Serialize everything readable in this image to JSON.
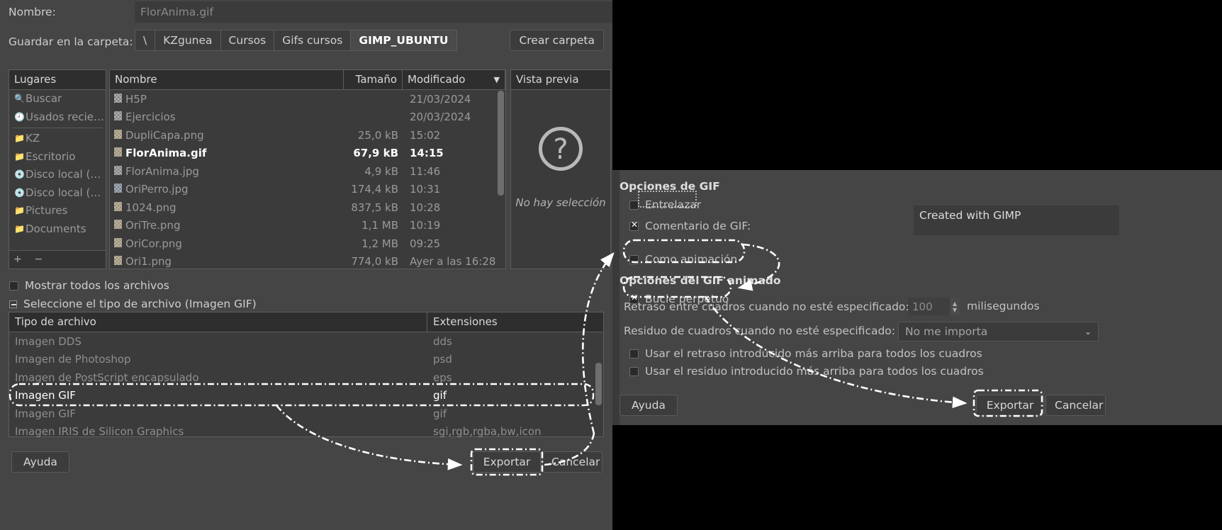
{
  "left_dialog": {
    "name_label": "Nombre:",
    "name_value": "FlorAnima.gif",
    "folder_label": "Guardar en la carpeta:",
    "breadcrumbs": [
      {
        "label": "\\",
        "active": false
      },
      {
        "label": "KZgunea",
        "active": false
      },
      {
        "label": "Cursos",
        "active": false
      },
      {
        "label": "Gifs cursos",
        "active": false
      },
      {
        "label": "GIMP_UBUNTU",
        "active": true
      }
    ],
    "create_folder_button": "Crear carpeta",
    "places_header": "Lugares",
    "places": [
      {
        "label": "Buscar",
        "icon": "search-icon"
      },
      {
        "label": "Usados recie…",
        "icon": "recent-icon"
      },
      {
        "label": "KZ",
        "icon": "folder-icon"
      },
      {
        "label": "Escritorio",
        "icon": "folder-icon"
      },
      {
        "label": "Disco local (…",
        "icon": "disk-icon"
      },
      {
        "label": "Disco local (…",
        "icon": "disk-icon"
      },
      {
        "label": "Pictures",
        "icon": "folder-icon"
      },
      {
        "label": "Documents",
        "icon": "folder-icon"
      }
    ],
    "places_add": "+",
    "places_remove": "−",
    "files_headers": {
      "name": "Nombre",
      "size": "Tamaño",
      "modified": "Modificado"
    },
    "files": [
      {
        "name": "H5P",
        "size": "",
        "modified": "21/03/2024",
        "thumb": "gray",
        "selected": false
      },
      {
        "name": "Ejercicios",
        "size": "",
        "modified": "20/03/2024",
        "thumb": "gray",
        "selected": false
      },
      {
        "name": "DupliCapa.png",
        "size": "25,0 kB",
        "modified": "15:02",
        "thumb": "tan",
        "selected": false
      },
      {
        "name": "FlorAnima.gif",
        "size": "67,9 kB",
        "modified": "14:15",
        "thumb": "tan",
        "selected": true
      },
      {
        "name": "FlorAnima.jpg",
        "size": "4,9 kB",
        "modified": "11:46",
        "thumb": "gray",
        "selected": false
      },
      {
        "name": "OriPerro.jpg",
        "size": "174,4 kB",
        "modified": "10:31",
        "thumb": "blue",
        "selected": false
      },
      {
        "name": "1024.png",
        "size": "837,5 kB",
        "modified": "10:28",
        "thumb": "tan",
        "selected": false
      },
      {
        "name": "OriTre.png",
        "size": "1,1 MB",
        "modified": "10:19",
        "thumb": "tan",
        "selected": false
      },
      {
        "name": "OriCor.png",
        "size": "1,2 MB",
        "modified": "09:25",
        "thumb": "tan",
        "selected": false
      },
      {
        "name": "Ori1.png",
        "size": "774,0 kB",
        "modified": "Ayer a las 16:28",
        "thumb": "tan",
        "selected": false
      }
    ],
    "preview_header": "Vista previa",
    "preview_placeholder": "?",
    "preview_text": "No hay selección",
    "show_all_files": "Mostrar todos los archivos",
    "select_file_type": "Seleccione el tipo de archivo (Imagen GIF)",
    "types_headers": {
      "type": "Tipo de archivo",
      "ext": "Extensiones"
    },
    "types": [
      {
        "type": "Imagen DDS",
        "ext": "dds",
        "selected": false
      },
      {
        "type": "Imagen de Photoshop",
        "ext": "psd",
        "selected": false
      },
      {
        "type": "Imagen de PostScript encapsulado",
        "ext": "eps",
        "selected": false
      },
      {
        "type": "Imagen GIF",
        "ext": "gif",
        "selected": true
      },
      {
        "type": "Imagen GIF",
        "ext": "gif",
        "selected": false
      },
      {
        "type": "Imagen IRIS de Silicon Graphics",
        "ext": "sgi,rgb,rgba,bw,icon",
        "selected": false
      }
    ],
    "help_button": "Ayuda",
    "export_button": "Exportar",
    "cancel_button": "Cancelar"
  },
  "right_dialog": {
    "section_gif": "Opciones de GIF",
    "interlace_label": "Entrelazar",
    "interlace_checked": false,
    "comment_label": "Comentario de GIF:",
    "comment_checked": true,
    "comment_value": "Created with GIMP",
    "as_animation_label": "Como animación",
    "as_animation_checked": false,
    "section_animated": "Opciones del GIF animado",
    "loop_label": "Bucle perpetuo",
    "loop_checked": true,
    "delay_label": "Retraso entre cuadros cuando no esté especificado:",
    "delay_value": "100",
    "delay_units": "milisegundos",
    "dispose_label": "Residuo de cuadros cuando no esté especificado:",
    "dispose_value": "No me importa",
    "use_delay_label": "Usar el retraso introducido más arriba para todos los cuadros",
    "use_delay_checked": false,
    "use_dispose_label": "Usar el residuo introducido más arriba para todos los cuadros",
    "use_dispose_checked": false,
    "help_button": "Ayuda",
    "export_button": "Exportar",
    "cancel_button": "Cancelar"
  },
  "colors": {
    "dialog_bg": "#454545",
    "field_bg": "#3b3b3b",
    "header_bg": "#2e2e2e",
    "text": "#c9c9c9",
    "text_dim": "#8e8e8e",
    "highlight": "#ffffff",
    "annotation": "#ffffff"
  }
}
